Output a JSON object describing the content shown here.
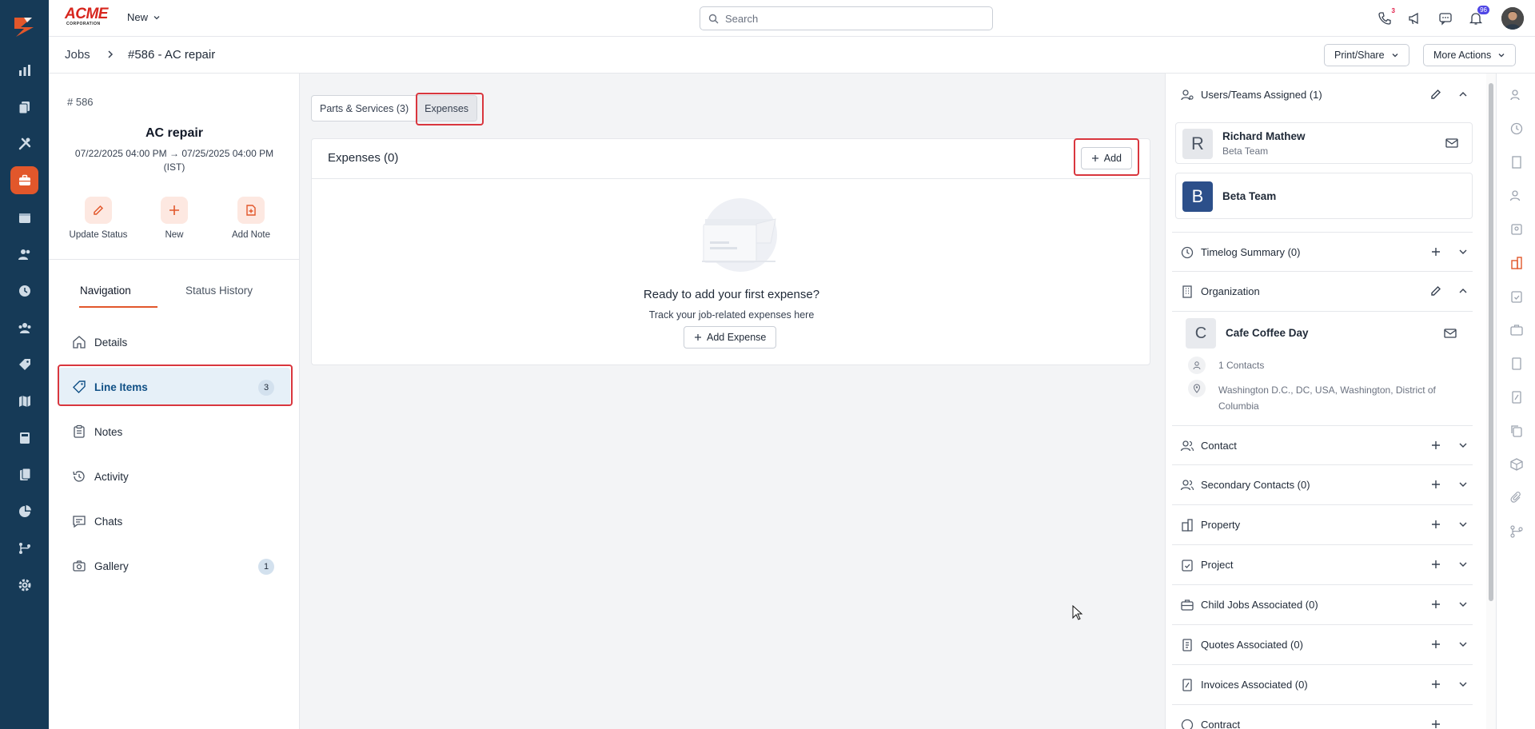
{
  "brand": {
    "main": "ACME",
    "sub": "CORPORATION"
  },
  "topbar": {
    "new_label": "New",
    "search_placeholder": "Search",
    "phone_badge": "3",
    "notif_badge": "96"
  },
  "breadcrumb": {
    "parent": "Jobs",
    "current": "#586 - AC repair",
    "print_share": "Print/Share",
    "more_actions": "More Actions"
  },
  "job": {
    "number": "# 586",
    "title": "AC repair",
    "dates_line1": "07/22/2025 04:00 PM → 07/25/2025 04:00 PM",
    "dates_line2": "(IST)",
    "actions": {
      "update_status": "Update Status",
      "new": "New",
      "add_note": "Add Note"
    }
  },
  "left_tabs": {
    "navigation": "Navigation",
    "status_history": "Status History"
  },
  "nav": {
    "details": "Details",
    "line_items": "Line Items",
    "line_items_count": "3",
    "notes": "Notes",
    "activity": "Activity",
    "chats": "Chats",
    "gallery": "Gallery",
    "gallery_count": "1"
  },
  "main": {
    "tab_parts": "Parts & Services (3)",
    "tab_expenses": "Expenses",
    "card_title": "Expenses (0)",
    "add_label": "Add",
    "empty_title": "Ready to add your first expense?",
    "empty_sub": "Track your job-related expenses here",
    "add_expense_label": "Add Expense"
  },
  "right": {
    "users_title": "Users/Teams Assigned (1)",
    "user_name": "Richard Mathew",
    "user_team": "Beta Team",
    "user_initial": "R",
    "team_name": "Beta Team",
    "team_initial": "B",
    "timelog": "Timelog Summary (0)",
    "organization": "Organization",
    "org_name": "Cafe Coffee Day",
    "org_initial": "C",
    "org_contacts": "1 Contacts",
    "org_address_line1": "Washington D.C., DC, USA, Washington, District of",
    "org_address_line2": "Columbia",
    "contact": "Contact",
    "secondary_contacts": "Secondary Contacts (0)",
    "property": "Property",
    "project": "Project",
    "child_jobs": "Child Jobs Associated (0)",
    "quotes": "Quotes Associated (0)",
    "invoices": "Invoices Associated (0)",
    "contract": "Contract"
  },
  "colors": {
    "rail": "#163a57",
    "accent": "#e2572b",
    "highlight": "#d9363e",
    "active_nav_bg": "#e6f0f8"
  }
}
